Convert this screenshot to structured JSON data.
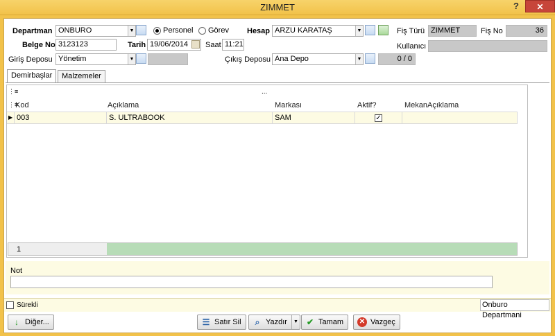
{
  "window": {
    "title": "ZIMMET",
    "help": "?",
    "close": "✕"
  },
  "form": {
    "departman": {
      "label": "Departman",
      "value": "ONBURO"
    },
    "personel": {
      "label": "Personel",
      "checked": true
    },
    "gorev": {
      "label": "Görev",
      "checked": false
    },
    "hesap": {
      "label": "Hesap",
      "value": "ARZU KARATAŞ"
    },
    "fis_turu": {
      "label": "Fiş Türü",
      "value": "ZIMMET"
    },
    "fis_no": {
      "label": "Fiş No",
      "value": "36"
    },
    "belge_no": {
      "label": "Belge No",
      "value": "3123123"
    },
    "tarih": {
      "label": "Tarih",
      "value": "19/06/2014"
    },
    "saat": {
      "label": "Saat",
      "value": "11:21"
    },
    "kullanici": {
      "label": "Kullanıcı",
      "value": ""
    },
    "giris_deposu": {
      "label": "Giriş Deposu",
      "value": "Yönetim"
    },
    "cikis_deposu": {
      "label": "Çıkış Deposu",
      "value": "Ana Depo",
      "counter": "0 / 0"
    }
  },
  "tabs": [
    {
      "label": "Demirbaşlar",
      "active": true
    },
    {
      "label": "Malzemeler",
      "active": false
    }
  ],
  "grid": {
    "group_text": "...",
    "columns": [
      "Kod",
      "Açıklama",
      "Markası",
      "Aktif?",
      "MekanAçıklama"
    ],
    "rows": [
      {
        "kod": "003",
        "aciklama": "S. ULTRABOOK",
        "markasi": "SAM",
        "aktif": true,
        "mekan": ""
      }
    ],
    "footer_count": "1"
  },
  "note": {
    "label": "Not",
    "value": ""
  },
  "status": {
    "surekli_label": "Sürekli",
    "surekli_checked": false,
    "department": "Onburo Departmani"
  },
  "buttons": {
    "diger": "Diğer...",
    "satir_sil": "Satır Sil",
    "yazdir": "Yazdır",
    "tamam": "Tamam",
    "vazgec": "Vazgeç"
  },
  "colors": {
    "accent": "#f2c24a",
    "note_bg": "#fdfbe3",
    "grid_footer": "#b7dcb7"
  }
}
